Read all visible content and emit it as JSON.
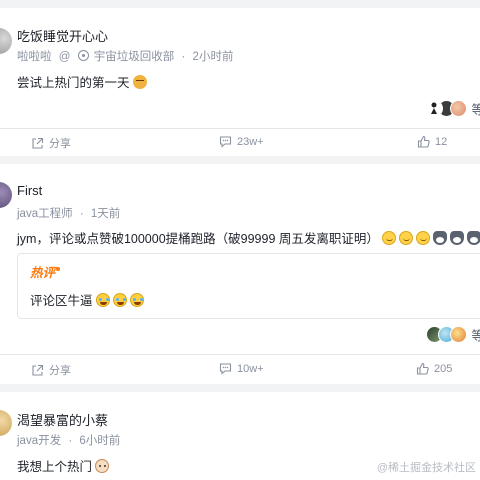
{
  "comments": [
    {
      "username": "吃饭睡觉开心心",
      "nickname": "啦啦啦",
      "company": "宇宙垃圾回收部",
      "time": "2小时前",
      "text": "尝试上热门的第一天",
      "reactors_more": "等",
      "share_label": "分享",
      "comment_count": "23w+",
      "like_count": "12"
    },
    {
      "username": "First",
      "job_title": "java工程师",
      "time": "1天前",
      "text": "jym，评论或点赞破100000提桶跑路（破99999 周五发离职证明）",
      "hot_tag": "热评",
      "hot_text": "评论区牛逼",
      "reactors_more": "等",
      "share_label": "分享",
      "comment_count": "10w+",
      "like_count": "205"
    },
    {
      "username": "渴望暴富的小蔡",
      "job_title": "java开发",
      "time": "6小时前",
      "text": "我想上个热门"
    }
  ],
  "watermark": "@稀土掘金技术社区",
  "icons": {
    "share": "share-icon",
    "comment": "comment-icon",
    "like": "thumbs-up-icon",
    "company": "building-icon"
  },
  "colors": {
    "page_bg": "#f2f3f5",
    "card_bg": "#ffffff",
    "text_primary": "#1d2129",
    "text_secondary": "#8a919f",
    "hot_accent": "#ff7a0c",
    "divider": "#e4e6eb"
  }
}
